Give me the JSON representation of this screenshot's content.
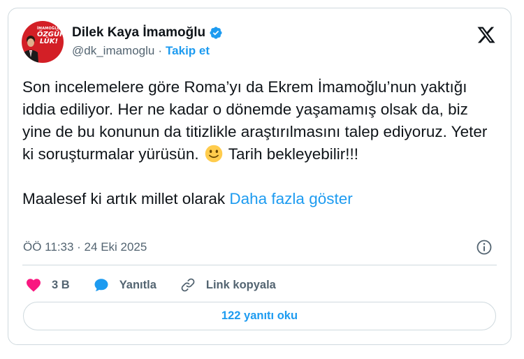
{
  "author": {
    "display_name": "Dilek Kaya İmamoğlu",
    "handle": "@dk_imamoglu",
    "separator": "·",
    "follow_label": "Takip et",
    "avatar_text": [
      "İMAMOĞLU'NA",
      "ÖZGÜR-",
      "LÜK!"
    ],
    "avatar_color": "#d31f26"
  },
  "tweet": {
    "paragraph1_before_emoji": "Son incelemelere göre Roma’yı da Ekrem İmamoğlu’nun yaktığı iddia ediliyor. Her ne kadar o dönemde yaşamamış olsak da, biz yine de bu konunun da titizlikle araştırılmasını talep ediyoruz. Yeter ki soruşturmalar yürüsün.",
    "paragraph1_after_emoji": "Tarih bekleyebilir!!!",
    "emoji": "slightly-smiling-face",
    "paragraph2": "Maalesef ki artık millet olarak",
    "show_more_label": "Daha fazla göster"
  },
  "meta": {
    "timestamp": "ÖÖ 11:33 · 24 Eki 2025",
    "info_icon": "info-icon"
  },
  "actions": {
    "like_count": "3 B",
    "reply_label": "Yanıtla",
    "copy_link_label": "Link kopyala"
  },
  "read_replies_label": "122 yanıtı oku",
  "colors": {
    "accent": "#1d9bf0",
    "like": "#f91880",
    "verified": "#1d9bf0",
    "secondary_text": "#536471",
    "border": "#cfd9de"
  }
}
